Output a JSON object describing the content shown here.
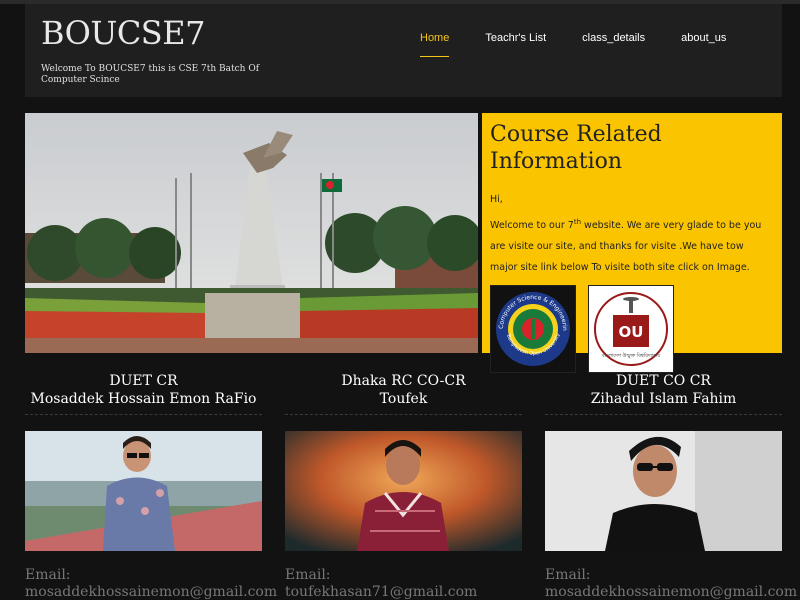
{
  "header": {
    "brand": "BOUCSE7",
    "tagline": "Welcome To BOUCSE7 this is CSE 7th Batch Of Computer Scince",
    "nav": [
      {
        "label": "Home"
      },
      {
        "label": "Teachr's List"
      },
      {
        "label": "class_details"
      },
      {
        "label": "about_us"
      }
    ]
  },
  "info": {
    "title": "Course Related Information",
    "greeting": "Hi,",
    "welcome_prefix": "Welcome to our 7",
    "welcome_sup": "th",
    "welcome_suffix": " website. We are very glade to be you are visite our site, and thanks for visite .We have tow major site link below To visite both site click on Image.",
    "logo1_ring_text": "Computer Science & Engineering",
    "logo1_bottom_text": "Bangladesh Open University",
    "logo2_mark": "OU",
    "logo2_bottom_text": "বাংলাদেশ উন্মুক্ত বিশ্ববিদ্যালয়"
  },
  "people": [
    {
      "role": "DUET CR",
      "name": "Mosaddek Hossain Emon RaFio",
      "email_label": "Email:",
      "email": "mosaddekhossainemon@gmail.com"
    },
    {
      "role": "Dhaka RC CO-CR",
      "name": "Toufek",
      "email_label": "Email:",
      "email": "toufekhasan71@gmail.com"
    },
    {
      "role": "DUET CO CR",
      "name": "Zihadul Islam Fahim",
      "email_label": "Email:",
      "email": "mosaddekhossainemon@gmail.com"
    }
  ],
  "colors": {
    "accent": "#f5c518",
    "info_bg": "#fbc400",
    "page_bg": "#121212",
    "header_bg": "#1f1f1f"
  }
}
